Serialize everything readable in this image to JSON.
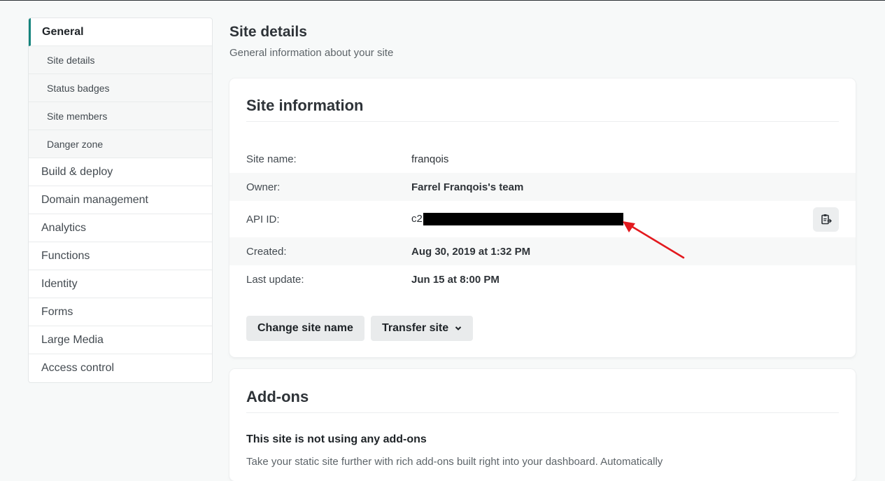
{
  "sidebar": {
    "items": [
      {
        "label": "General"
      },
      {
        "label": "Build & deploy"
      },
      {
        "label": "Domain management"
      },
      {
        "label": "Analytics"
      },
      {
        "label": "Functions"
      },
      {
        "label": "Identity"
      },
      {
        "label": "Forms"
      },
      {
        "label": "Large Media"
      },
      {
        "label": "Access control"
      }
    ],
    "subitems": [
      {
        "label": "Site details"
      },
      {
        "label": "Status badges"
      },
      {
        "label": "Site members"
      },
      {
        "label": "Danger zone"
      }
    ]
  },
  "page": {
    "title": "Site details",
    "subtitle": "General information about your site"
  },
  "site_info": {
    "title": "Site information",
    "rows": [
      {
        "label": "Site name:",
        "value": "franqois"
      },
      {
        "label": "Owner:",
        "value": "Farrel Franqois's team"
      },
      {
        "label": "API ID:",
        "value": "c2"
      },
      {
        "label": "Created:",
        "value": "Aug 30, 2019 at 1:32 PM"
      },
      {
        "label": "Last update:",
        "value": "Jun 15 at 8:00 PM"
      }
    ],
    "change_name_label": "Change site name",
    "transfer_label": "Transfer site"
  },
  "addons": {
    "title": "Add-ons",
    "heading": "This site is not using any add-ons",
    "text": "Take your static site further with rich add-ons built right into your dashboard. Automatically"
  },
  "colors": {
    "accent": "#15847d",
    "annotation_arrow": "#e3191e"
  }
}
